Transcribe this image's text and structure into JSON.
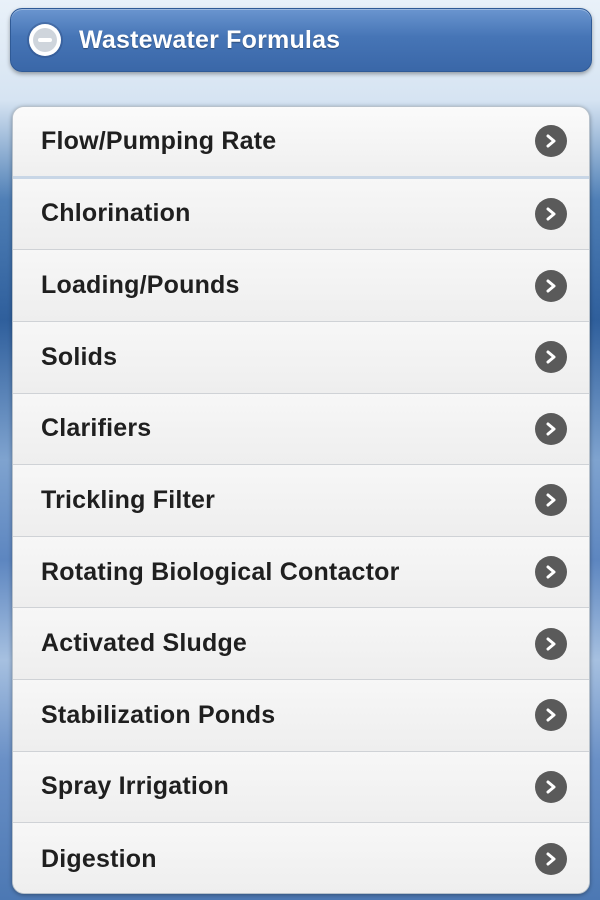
{
  "header": {
    "title": "Wastewater Formulas",
    "icon": "minus-circle-icon",
    "background_color": "#4675b6"
  },
  "menu": {
    "item_icon": "chevron-right-circle-icon",
    "items": [
      {
        "label": "Flow/Pumping Rate"
      },
      {
        "label": "Chlorination"
      },
      {
        "label": "Loading/Pounds"
      },
      {
        "label": "Solids"
      },
      {
        "label": "Clarifiers"
      },
      {
        "label": "Trickling Filter"
      },
      {
        "label": "Rotating Biological Contactor"
      },
      {
        "label": "Activated Sludge"
      },
      {
        "label": "Stabilization Ponds"
      },
      {
        "label": "Spray Irrigation"
      },
      {
        "label": "Digestion"
      }
    ]
  }
}
